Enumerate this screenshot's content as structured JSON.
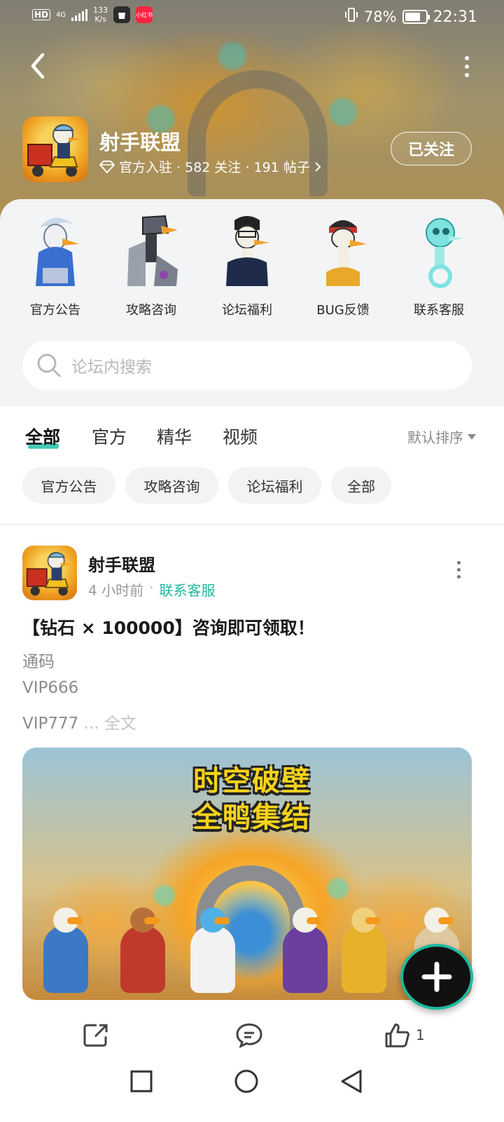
{
  "status_bar": {
    "network": "HD",
    "net_type": "4G",
    "speed_value": "133",
    "speed_unit": "K/s",
    "app_badge": "小红书",
    "battery": "78%",
    "battery_level": 0.78,
    "time": "22:31"
  },
  "header": {
    "forum_name": "射手联盟",
    "meta": "官方入驻 · 582 关注 · 191 帖子",
    "follow_label": "已关注",
    "verified_icon": "diamond-icon",
    "back_icon": "chevron-left-icon",
    "more_icon": "more-vertical-icon"
  },
  "shortcuts": [
    {
      "label": "官方公告"
    },
    {
      "label": "攻略咨询"
    },
    {
      "label": "论坛福利"
    },
    {
      "label": "BUG反馈"
    },
    {
      "label": "联系客服"
    }
  ],
  "search": {
    "placeholder": "论坛内搜索"
  },
  "tabs": [
    {
      "label": "全部",
      "active": true
    },
    {
      "label": "官方"
    },
    {
      "label": "精华"
    },
    {
      "label": "视频"
    }
  ],
  "sort_label": "默认排序",
  "chips": [
    "官方公告",
    "攻略咨询",
    "论坛福利",
    "全部"
  ],
  "post": {
    "author": "射手联盟",
    "time": "4 小时前",
    "category": "联系客服",
    "title": "【钻石 × 100000】咨询即可领取！",
    "lines": [
      "通码",
      "VIP666",
      "VIP777"
    ],
    "ellipsis": "...",
    "read_more": "全文",
    "banner_text_line1": "时空破壁",
    "banner_text_line2": "全鸭集结",
    "like_count": "1"
  },
  "colors": {
    "accent": "#1fb8a0",
    "chip_bg": "#f2f3f5",
    "sheet_bg": "#f3f4f6",
    "banner_text": "#f7d21a"
  }
}
